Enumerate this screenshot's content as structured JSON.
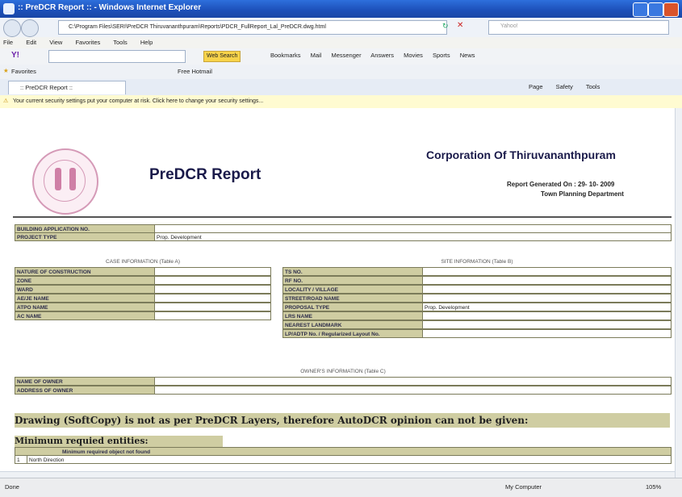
{
  "window": {
    "title": ":: PreDCR Report ::  - Windows Internet Explorer"
  },
  "address": {
    "url": "C:\\Program Files\\SERI\\PreDCR Thiruvananthpuram\\Reports\\PDCR_FullReport_Lal_PreDCR.dwg.html",
    "search_placeholder": "Yahoo!"
  },
  "menu": {
    "items": [
      "File",
      "Edit",
      "View",
      "Favorites",
      "Tools",
      "Help"
    ]
  },
  "yahoo_toolbar": {
    "web_search": "Web Search",
    "items": [
      "Bookmarks",
      "Mail",
      "Messenger",
      "Answers",
      "Movies",
      "Sports",
      "News"
    ]
  },
  "favorites_bar": {
    "label": "Favorites",
    "items": [
      "Free Hotmail"
    ]
  },
  "tab": {
    "label": ":: PreDCR Report ::"
  },
  "command_bar": {
    "items": [
      "Page",
      "Safety",
      "Tools"
    ]
  },
  "infobar": {
    "text": "Your current security settings put your computer at risk. Click here to change your security settings..."
  },
  "report": {
    "title": "PreDCR Report",
    "org": "Corporation Of Thiruvananthpuram",
    "generated_label": "Report Generated On : 29- 10- 2009",
    "department": "Town Planning Department",
    "building_application_no_label": "BUILDING APPLICATION NO.",
    "project_type_label": "PROJECT TYPE",
    "project_type_value": "Prop. Development",
    "case_section": "CASE INFORMATION (Table A)",
    "case_rows": [
      "NATURE OF CONSTRUCTION",
      "ZONE",
      "WARD",
      "AE/JE NAME",
      "ATPO NAME",
      "AC NAME"
    ],
    "site_section": "SITE INFORMATION (Table B)",
    "site_rows": [
      "TS NO.",
      "RF NO.",
      "LOCALITY / VILLAGE",
      "STREET/ROAD NAME",
      "PROPOSAL TYPE",
      "LRS NAME",
      "NEAREST LANDMARK",
      "LP/ADTP No. / Regularized Layout No."
    ],
    "site_proposal_value": "Prop. Development",
    "owner_section": "OWNER'S INFORMATION (Table C)",
    "owner_rows": [
      "NAME OF OWNER",
      "ADDRESS OF OWNER"
    ],
    "warning": "Drawing (SoftCopy) is not as per PreDCR Layers, therefore AutoDCR opinion can not be given:",
    "min_heading": "Minimum requied entities:",
    "min_table_header": "Minimum required object not found",
    "min_row_no": "1",
    "min_row_value": "North Direction"
  },
  "status": {
    "left": "Done",
    "zone": "My Computer",
    "zoom": "105%"
  }
}
